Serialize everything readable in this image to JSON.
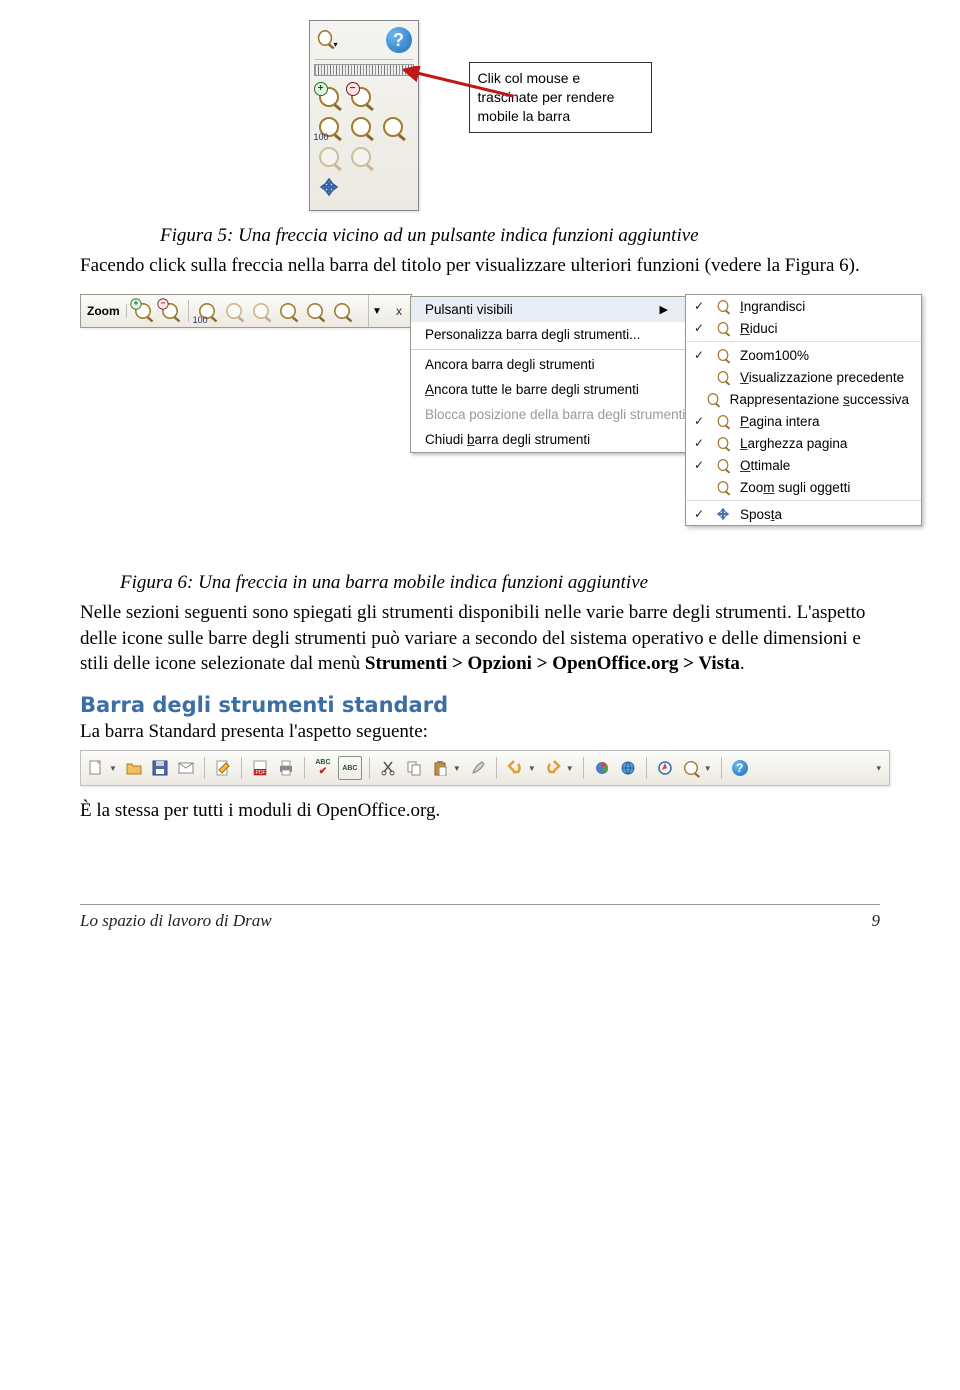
{
  "figure5": {
    "callout": "Clik col mouse e trascinate per rendere mobile la barra",
    "label_100": "100",
    "caption": "Figura 5: Una freccia vicino ad un pulsante indica funzioni aggiuntive"
  },
  "para1": "Facendo click sulla freccia nella barra del titolo per visualizzare ulteriori funzioni (vedere la Figura 6).",
  "figure6": {
    "zoom_label": "Zoom",
    "zoom_100": "100",
    "context_menu": [
      "Pulsanti visibili",
      "Personalizza barra degli strumenti...",
      "Ancora barra degli strumenti",
      "Ancora tutte le barre degli strumenti",
      "Blocca posizione della barra degli strumenti",
      "Chiudi barra degli strumenti"
    ],
    "submenu": [
      {
        "chk": true,
        "label": "Ingrandisci"
      },
      {
        "chk": true,
        "label": "Riduci"
      },
      {
        "chk": true,
        "label": "Zoom100%"
      },
      {
        "chk": false,
        "label": "Visualizzazione precedente"
      },
      {
        "chk": false,
        "label": "Rappresentazione successiva"
      },
      {
        "chk": true,
        "label": "Pagina intera"
      },
      {
        "chk": true,
        "label": "Larghezza pagina"
      },
      {
        "chk": true,
        "label": "Ottimale"
      },
      {
        "chk": false,
        "label": "Zoom sugli oggetti"
      },
      {
        "chk": true,
        "label": "Sposta"
      }
    ],
    "caption": "Figura 6: Una freccia in una barra mobile indica funzioni aggiuntive"
  },
  "para2": {
    "pre": "Nelle sezioni seguenti sono spiegati gli strumenti disponibili nelle varie barre degli strumenti. L'aspetto delle icone sulle barre degli strumenti può variare a secondo del sistema operativo e delle dimensioni e stili delle icone selezionate dal menù ",
    "bold": "Strumenti > Opzioni > OpenOffice.org > Vista",
    "post": "."
  },
  "section": {
    "heading": "Barra degli strumenti standard",
    "intro": "La barra Standard presenta l'aspetto seguente:",
    "outro": "È la stessa per tutti i moduli di OpenOffice.org."
  },
  "std_icons": {
    "abc1": "ABC",
    "abc2": "ABC"
  },
  "footer": {
    "left": "Lo spazio di lavoro di Draw",
    "right": "9"
  }
}
